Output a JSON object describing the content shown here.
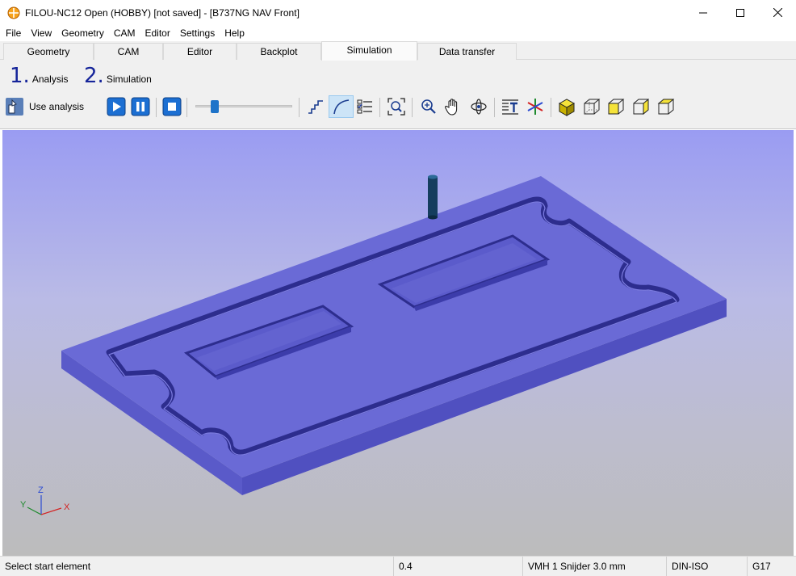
{
  "window": {
    "title": "FILOU-NC12 Open (HOBBY)   [not saved] - [B737NG NAV Front]"
  },
  "menu": [
    "File",
    "View",
    "Geometry",
    "CAM",
    "Editor",
    "Settings",
    "Help"
  ],
  "tabs": [
    "Geometry",
    "CAM",
    "Editor",
    "Backplot",
    "Simulation",
    "Data transfer"
  ],
  "active_tab": "Simulation",
  "steps": [
    {
      "number": "1.",
      "label": "Analysis"
    },
    {
      "number": "2.",
      "label": "Simulation"
    }
  ],
  "toolbar": {
    "use_analysis_label": "Use analysis",
    "speed_slider_level": 0.17,
    "buttons": [
      "play-icon",
      "pause-icon",
      "stop-icon",
      "step-line-icon",
      "arc-line-icon",
      "checklist-icon",
      "zoom-fit-icon",
      "zoom-icon",
      "pan-hand-icon",
      "rotate-icon",
      "text-icon",
      "axes-icon",
      "solid-cube-icon",
      "wire-cube-icon",
      "yellow-face-cube-icon",
      "wire-cube-2-icon",
      "wire-cube-3-icon"
    ],
    "pressed": "arc-line-icon"
  },
  "axes": {
    "z": "Z",
    "y": "Y",
    "x": "X"
  },
  "status": {
    "message": "Select start element",
    "value": "0.4",
    "tool": "VMH 1 Snijder 3.0 mm",
    "format": "DIN-ISO",
    "plane": "G17"
  },
  "colors": {
    "accent": "#16259a",
    "plate_top": "#6a6ad6",
    "plate_side": "#5656c8",
    "slot": "#2e2e8a"
  }
}
